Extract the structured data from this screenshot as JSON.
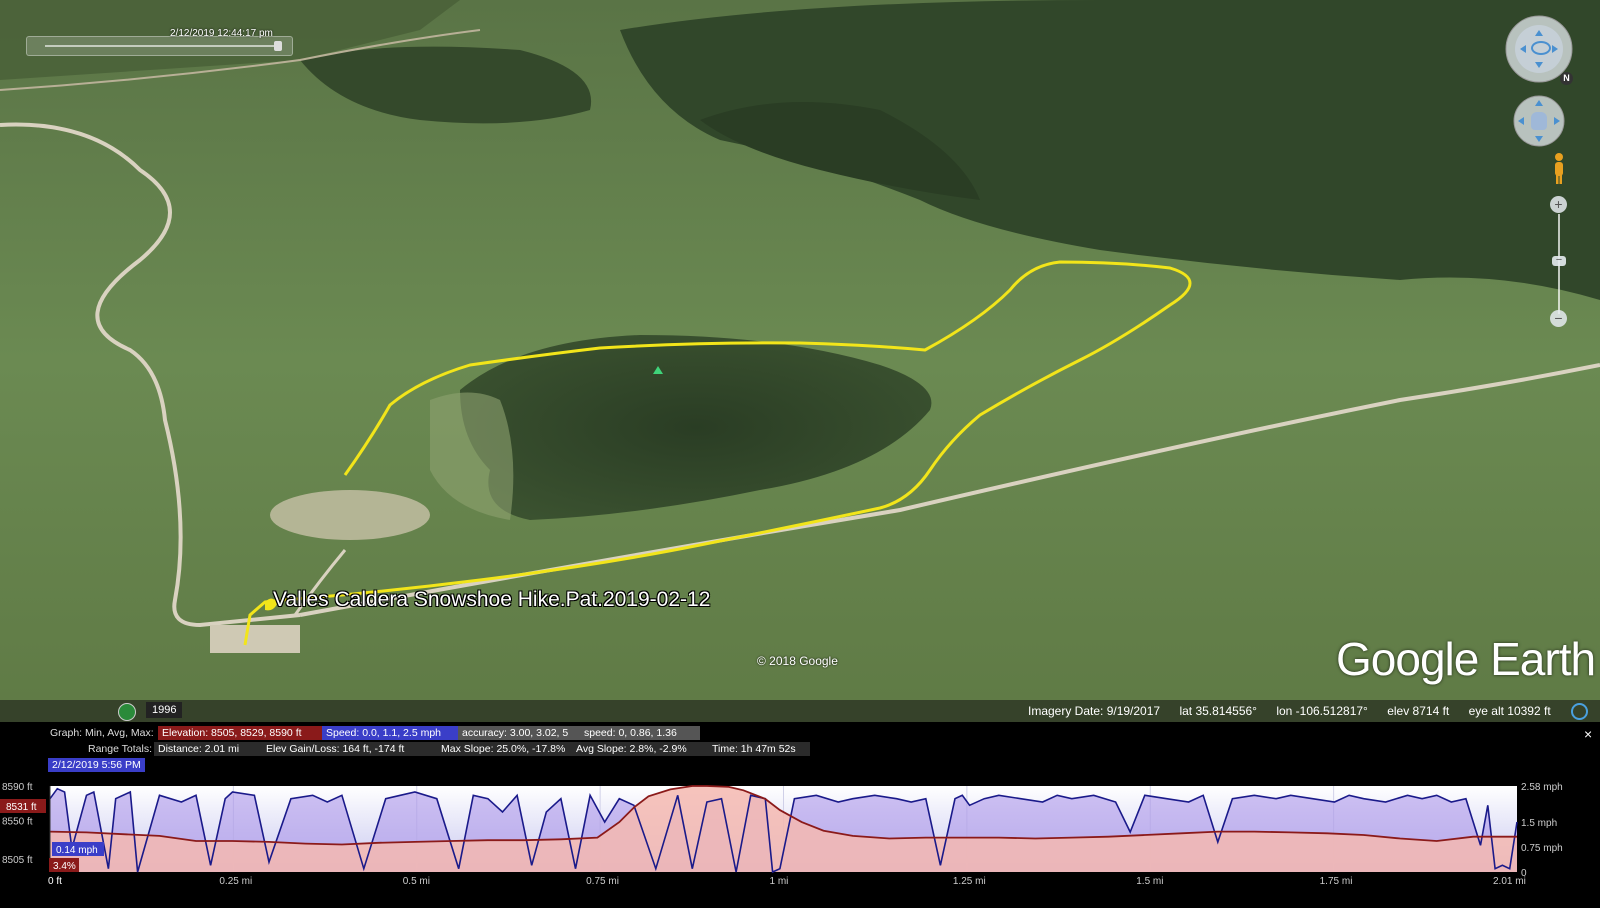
{
  "time_slider": {
    "timestamp": "2/12/2019  12:44:17 pm"
  },
  "map": {
    "track_label": "Valles Caldera Snowshoe Hike.Pat.2019-02-12",
    "copyright": "© 2018 Google",
    "logo": "Google Earth",
    "colors": {
      "track": "#f2e51a",
      "terrain": "#6c8a4e",
      "forest": "#2e4526",
      "road": "#d9d2c0"
    }
  },
  "nav_controls": {
    "look_joystick_icon": "eye-icon",
    "move_joystick_icon": "hand-icon",
    "street_view_icon": "pegman-icon",
    "north_label": "N",
    "zoom_in_label": "+",
    "zoom_out_label": "−",
    "zoom_mid_label": "−"
  },
  "status_bar": {
    "year": "1996",
    "imagery_date": "Imagery Date: 9/19/2017",
    "lat": "lat   35.814556°",
    "lon": "lon  -106.512817°",
    "elev": "elev  8714 ft",
    "eye_alt": "eye alt  10392 ft"
  },
  "elevation_panel": {
    "close_label": "×",
    "graph_label": "Graph: Min, Avg, Max:",
    "elevation": "Elevation: 8505, 8529, 8590 ft",
    "speed": "Speed: 0.0, 1.1, 2.5 mph",
    "accuracy": "accuracy: 3.00, 3.02, 5",
    "speed2": "speed: 0, 0.86, 1.36",
    "range_label": "Range Totals:",
    "distance": "Distance: 2.01 mi",
    "elev_gain_loss": "Elev Gain/Loss: 164 ft, -174 ft",
    "max_slope": "Max Slope: 25.0%, -17.8%",
    "avg_slope": "Avg Slope: 2.8%, -2.9%",
    "time": "Time: 1h 47m 52s",
    "cursor_date": "2/12/2019 5:56 PM",
    "cursor_elev": "8531 ft",
    "cursor_speed": "0.14 mph",
    "cursor_slope": "3.4%"
  },
  "chart_data": {
    "type": "area",
    "x_ticks": [
      "0 ft",
      "0.25 mi",
      "0.5 mi",
      "0.75 mi",
      "1 mi",
      "1.25 mi",
      "1.5 mi",
      "1.75 mi",
      "2.01 mi"
    ],
    "left_ticks": [
      "8590 ft",
      "8550 ft",
      "8505 ft"
    ],
    "right_ticks": [
      "2.58 mph",
      "1.5 mph",
      "0.75 mph",
      "0"
    ],
    "xlim": [
      0,
      2.01
    ],
    "ylim_elevation": [
      8490,
      8590
    ],
    "ylim_speed": [
      0,
      2.58
    ],
    "series": [
      {
        "name": "Elevation",
        "color": "#8b1a1a",
        "x": [
          0,
          0.05,
          0.1,
          0.15,
          0.2,
          0.25,
          0.3,
          0.35,
          0.4,
          0.45,
          0.5,
          0.55,
          0.6,
          0.65,
          0.7,
          0.75,
          0.78,
          0.8,
          0.82,
          0.85,
          0.88,
          0.9,
          0.93,
          0.95,
          0.98,
          1.0,
          1.03,
          1.06,
          1.1,
          1.15,
          1.2,
          1.25,
          1.3,
          1.35,
          1.4,
          1.45,
          1.5,
          1.55,
          1.6,
          1.65,
          1.7,
          1.75,
          1.8,
          1.85,
          1.9,
          1.95,
          2.01
        ],
        "values": [
          8537,
          8536,
          8534,
          8532,
          8526,
          8526,
          8525,
          8523,
          8522,
          8524,
          8525,
          8526,
          8527,
          8527,
          8528,
          8530,
          8548,
          8565,
          8578,
          8586,
          8590,
          8590,
          8589,
          8585,
          8575,
          8562,
          8548,
          8538,
          8532,
          8529,
          8530,
          8530,
          8530,
          8529,
          8530,
          8531,
          8533,
          8535,
          8537,
          8537,
          8536,
          8535,
          8533,
          8529,
          8526,
          8531,
          8531
        ]
      },
      {
        "name": "Speed",
        "color": "#1a1a8a",
        "x": [
          0,
          0.01,
          0.02,
          0.03,
          0.05,
          0.06,
          0.08,
          0.09,
          0.11,
          0.12,
          0.15,
          0.18,
          0.2,
          0.22,
          0.24,
          0.25,
          0.28,
          0.3,
          0.33,
          0.36,
          0.38,
          0.4,
          0.43,
          0.46,
          0.48,
          0.5,
          0.53,
          0.56,
          0.58,
          0.6,
          0.62,
          0.64,
          0.66,
          0.68,
          0.7,
          0.72,
          0.74,
          0.76,
          0.78,
          0.8,
          0.83,
          0.86,
          0.88,
          0.9,
          0.92,
          0.94,
          0.96,
          0.98,
          0.99,
          1.0,
          1.02,
          1.05,
          1.08,
          1.1,
          1.13,
          1.16,
          1.18,
          1.2,
          1.22,
          1.24,
          1.25,
          1.26,
          1.28,
          1.3,
          1.33,
          1.36,
          1.38,
          1.4,
          1.43,
          1.46,
          1.48,
          1.5,
          1.53,
          1.56,
          1.58,
          1.6,
          1.62,
          1.65,
          1.68,
          1.7,
          1.73,
          1.76,
          1.78,
          1.8,
          1.83,
          1.86,
          1.88,
          1.9,
          1.92,
          1.94,
          1.96,
          1.97,
          1.98,
          1.99,
          2.0,
          2.01
        ],
        "values": [
          2.2,
          2.5,
          2.4,
          0.7,
          2.3,
          2.4,
          0.1,
          2.2,
          2.4,
          0.0,
          2.3,
          2.1,
          2.3,
          0.2,
          2.2,
          2.4,
          2.3,
          0.3,
          2.2,
          2.3,
          2.1,
          2.3,
          0.1,
          2.2,
          2.3,
          2.4,
          2.2,
          0.1,
          2.3,
          2.2,
          1.8,
          2.3,
          0.2,
          1.8,
          2.2,
          0.1,
          2.3,
          1.5,
          2.2,
          2.0,
          0.1,
          2.3,
          0.1,
          2.1,
          2.2,
          0.0,
          2.3,
          2.2,
          0.0,
          0.1,
          2.2,
          2.3,
          2.1,
          2.2,
          2.3,
          2.2,
          2.1,
          2.2,
          0.2,
          2.2,
          2.3,
          2.0,
          2.2,
          2.3,
          2.2,
          2.1,
          2.3,
          2.2,
          2.3,
          2.1,
          1.2,
          2.3,
          2.2,
          2.1,
          2.3,
          0.9,
          2.2,
          2.3,
          2.2,
          2.3,
          2.2,
          2.1,
          2.3,
          2.2,
          2.1,
          2.3,
          2.2,
          2.3,
          2.1,
          2.2,
          0.8,
          2.0,
          0.1,
          0.2,
          0.1,
          1.5
        ]
      }
    ]
  }
}
